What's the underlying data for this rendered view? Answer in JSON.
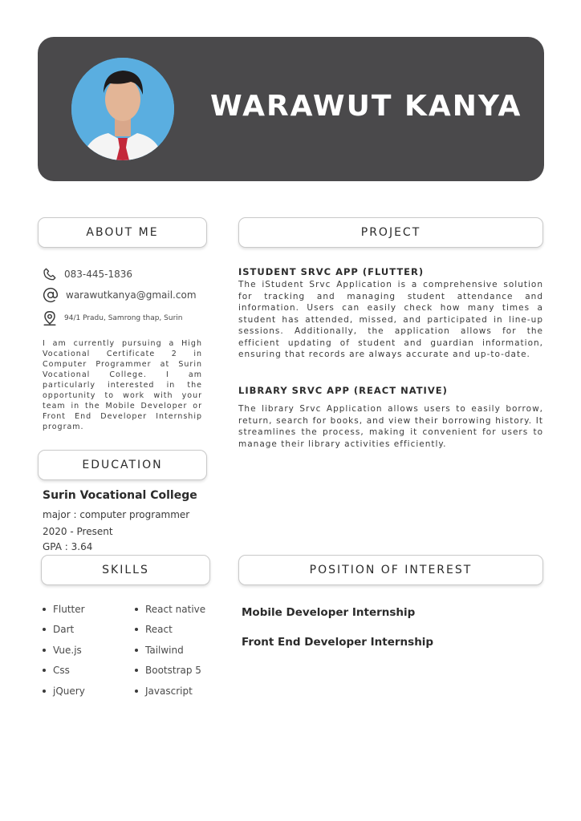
{
  "header": {
    "name": "WARAWUT KANYA"
  },
  "sections": {
    "about_me": "ABOUT ME",
    "project": "PROJECT",
    "education": "EDUCATION",
    "skills": "SKILLS",
    "position_of_interest": "POSITION OF INTEREST"
  },
  "contact": {
    "phone": "083-445-1836",
    "email": "warawutkanya@gmail.com",
    "address": "94/1 Pradu, Samrong thap, Surin"
  },
  "about": {
    "text": "I am currently pursuing a High Vocational Certificate 2 in Computer Programmer at Surin Vocational College. I am particularly interested in the opportunity to work with your team in the Mobile Developer or Front End Developer Internship program."
  },
  "projects": [
    {
      "title": "ISTUDENT SRVC APP (FLUTTER)",
      "description": "The iStudent Srvc Application is a comprehensive solution for tracking and managing student attendance and information. Users can easily check how many times a student has attended, missed, and participated in line-up sessions. Additionally, the application allows for the efficient updating of student and guardian information, ensuring that records are always accurate and up-to-date."
    },
    {
      "title": "LIBRARY SRVC APP (REACT NATIVE)",
      "description": "The library Srvc Application allows users to easily borrow, return, search for books, and view their borrowing history. It streamlines the process, making it convenient for users to manage their library activities efficiently."
    }
  ],
  "education": {
    "school": "Surin Vocational College",
    "major": "major : computer programmer",
    "years": "2020 - Present",
    "gpa": "GPA : 3.64"
  },
  "skills": {
    "left": [
      "Flutter",
      "Dart",
      "Vue.js",
      "Css",
      "jQuery"
    ],
    "right": [
      "React native",
      "React",
      "Tailwind",
      "Bootstrap 5",
      "Javascript"
    ]
  },
  "positions": [
    "Mobile Developer Internship",
    "Front End Developer Internship"
  ],
  "icons": {
    "phone": "phone-icon",
    "email": "at-sign-icon",
    "address": "map-pin-icon"
  },
  "colors": {
    "header_bg": "#4a494b",
    "header_text": "#ffffff",
    "photo_bg": "#5aaee0"
  }
}
